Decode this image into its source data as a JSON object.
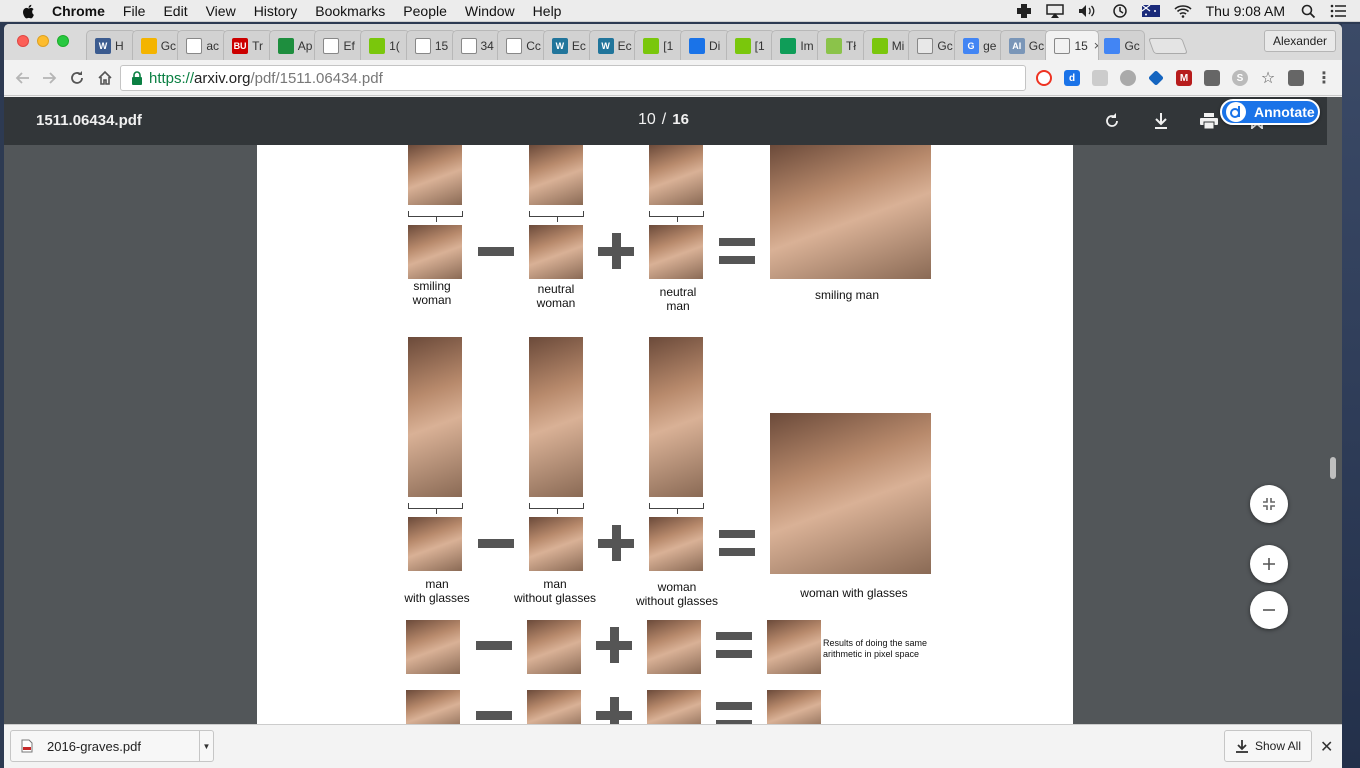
{
  "menubar": {
    "app_name": "Chrome",
    "items": [
      "File",
      "Edit",
      "View",
      "History",
      "Bookmarks",
      "People",
      "Window",
      "Help"
    ],
    "clock": "Thu 9:08 AM"
  },
  "browser": {
    "tabs": [
      {
        "title": "H",
        "favicon_color": "#3b5b8f",
        "favicon_char": "W"
      },
      {
        "title": "Gc",
        "favicon_color": "#f4b400",
        "favicon_char": ""
      },
      {
        "title": "ac",
        "favicon_color": "#ffffff",
        "favicon_char": ""
      },
      {
        "title": "Tr",
        "favicon_color": "#cc0000",
        "favicon_char": "BU"
      },
      {
        "title": "Ap",
        "favicon_color": "#1e8e3e",
        "favicon_char": ""
      },
      {
        "title": "Ef",
        "favicon_color": "#ffffff",
        "favicon_char": ""
      },
      {
        "title": "1(",
        "favicon_color": "#7ac70c",
        "favicon_char": ""
      },
      {
        "title": "15",
        "favicon_color": "#ffffff",
        "favicon_char": ""
      },
      {
        "title": "34",
        "favicon_color": "#ffffff",
        "favicon_char": ""
      },
      {
        "title": "Cc",
        "favicon_color": "#ffffff",
        "favicon_char": ""
      },
      {
        "title": "Ec",
        "favicon_color": "#21759b",
        "favicon_char": "W"
      },
      {
        "title": "Ec",
        "favicon_color": "#21759b",
        "favicon_char": "W"
      },
      {
        "title": "[1",
        "favicon_color": "#7ac70c",
        "favicon_char": ""
      },
      {
        "title": "Di",
        "favicon_color": "#1a73e8",
        "favicon_char": ""
      },
      {
        "title": "[1",
        "favicon_color": "#7ac70c",
        "favicon_char": ""
      },
      {
        "title": "Im",
        "favicon_color": "#0f9d58",
        "favicon_char": ""
      },
      {
        "title": "Tł",
        "favicon_color": "#8bc34a",
        "favicon_char": ""
      },
      {
        "title": "Mi",
        "favicon_color": "#7ac70c",
        "favicon_char": ""
      },
      {
        "title": "Gc",
        "favicon_color": "#e8e8e8",
        "favicon_char": ""
      },
      {
        "title": "ge",
        "favicon_color": "#4285f4",
        "favicon_char": "G"
      },
      {
        "title": "Gc",
        "favicon_color": "#7a96b8",
        "favicon_char": "AI"
      },
      {
        "title": "15",
        "favicon_color": "#f2f2f2",
        "favicon_char": "",
        "active": true
      },
      {
        "title": "Gc",
        "favicon_color": "#4285f4",
        "favicon_char": ""
      }
    ],
    "active_close": "×",
    "profile": "Alexander",
    "url": {
      "scheme": "https://",
      "host": "arxiv.org",
      "path": "/pdf/1511.06434.pdf"
    }
  },
  "pdf": {
    "title": "1511.06434.pdf",
    "current_page": "10",
    "page_sep": "/",
    "total_pages": "16",
    "annotate_label": "Annotate"
  },
  "figure": {
    "row1": {
      "captions": [
        "smiling\nwoman",
        "neutral\nwoman",
        "neutral\nman",
        "smiling man"
      ]
    },
    "row2": {
      "captions": [
        "man\nwith glasses",
        "man\nwithout glasses",
        "woman\nwithout glasses",
        "woman with glasses"
      ]
    },
    "row3": {
      "caption": "Results of doing the same\narithmetic in pixel space"
    }
  },
  "shelf": {
    "download_file": "2016-graves.pdf",
    "show_all": "Show All"
  }
}
